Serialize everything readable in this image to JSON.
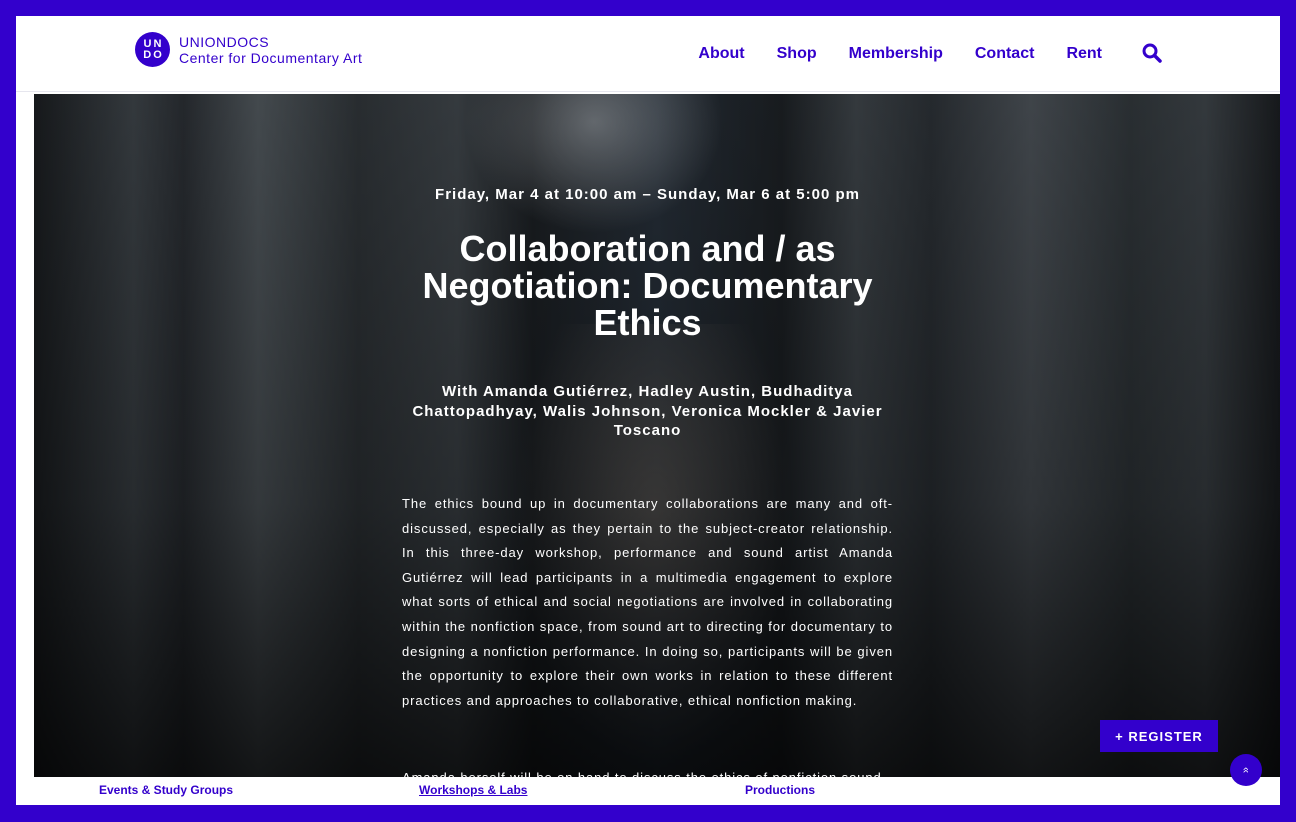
{
  "header": {
    "logo_line1": "UN",
    "logo_line2": "DO",
    "brand_name": "UNIONDOCS",
    "brand_tagline": "Center for Documentary Art",
    "nav": [
      "About",
      "Shop",
      "Membership",
      "Contact",
      "Rent"
    ],
    "search_icon": "search-icon"
  },
  "event": {
    "date": "Friday, Mar 4 at 10:00 am – Sunday, Mar 6 at 5:00 pm",
    "title": "Collaboration and / as Negotiation: Documentary Ethics",
    "speakers": "With Amanda Gutiérrez, Hadley Austin, Budhaditya Chattopadhyay, Walis Johnson, Veronica Mockler & Javier Toscano",
    "description": "The ethics bound up in documentary collaborations are many and oft-discussed, especially as they pertain to the subject-creator relationship. In this three-day workshop, performance and sound artist Amanda Gutiérrez will lead participants in a multimedia engagement to explore what sorts of ethical and social negotiations are involved in collaborating within the nonfiction space, from sound art to directing for documentary to designing a nonfiction performance. In doing so, participants will be given the opportunity to explore their own works in relation to these different practices and approaches to collaborative, ethical nonfiction making.",
    "description_2": "Amanda herself will be on hand to discuss the ethics of nonfiction sound"
  },
  "register_label": "+ REGISTER",
  "scroll_top_glyph": "»",
  "footer": {
    "events": "Events & Study Groups",
    "workshops": "Workshops & Labs",
    "productions": "Productions"
  },
  "colors": {
    "accent": "#3300cc",
    "background": "#ffffff"
  }
}
